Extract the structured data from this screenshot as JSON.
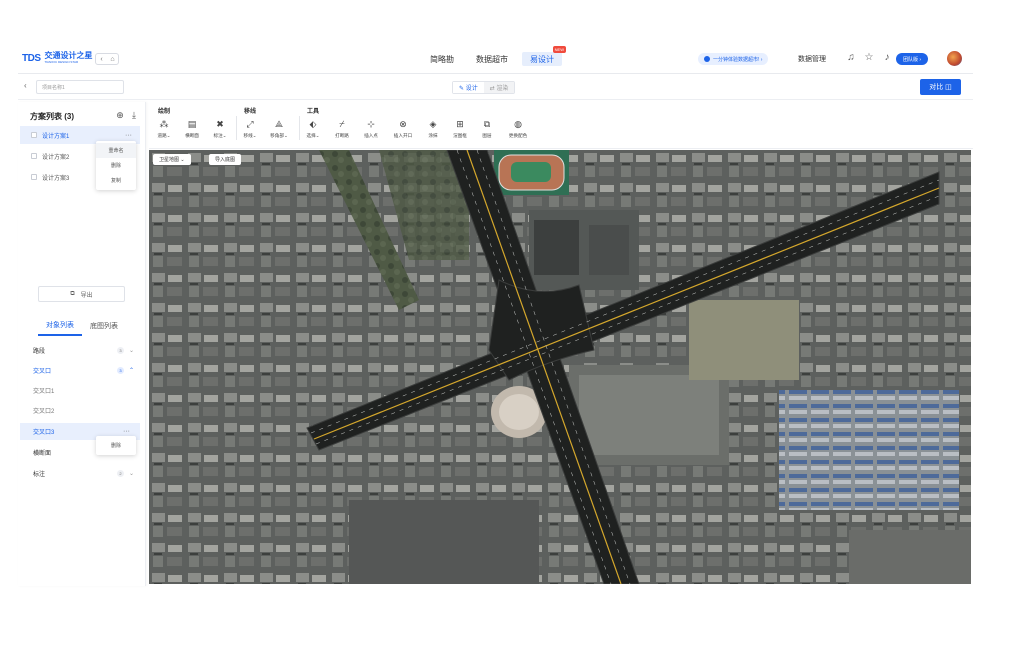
{
  "topbar": {
    "logo_mark": "TDS",
    "logo_cn": "交通设计之星",
    "logo_en": "TRAFFIC DESIGN STAR",
    "home_controls": [
      "‹",
      "⌂"
    ],
    "nav": [
      {
        "label": "简略勘",
        "active": false
      },
      {
        "label": "数据超市",
        "active": false
      },
      {
        "label": "易设计",
        "active": true,
        "badge": "NEW"
      }
    ],
    "promo": "一分钟体验数据超市! ›",
    "data_mgmt": "数据管理",
    "icons": [
      "headset-icon",
      "star-icon",
      "bell-icon"
    ],
    "team_btn": "团队版 ›"
  },
  "subbar": {
    "back": "‹",
    "project_name_placeholder": "项目名称1",
    "modes": [
      {
        "label": "✎ 设计",
        "active": true
      },
      {
        "label": "⇄ 渲染",
        "active": false
      }
    ],
    "compare_btn": "对比 ◫"
  },
  "left": {
    "title": "方案列表 (3)",
    "schemes": [
      {
        "label": "设计方案1",
        "selected": true
      },
      {
        "label": "设计方案2",
        "selected": false
      },
      {
        "label": "设计方案3",
        "selected": false
      }
    ],
    "scheme_menu": [
      "重命名",
      "删除",
      "复制"
    ],
    "export": "导出",
    "tabs": [
      {
        "label": "对象列表",
        "active": true
      },
      {
        "label": "底图列表",
        "active": false
      }
    ],
    "objects": [
      {
        "label": "路段",
        "count": "3",
        "chev": "⌄",
        "type": "group"
      },
      {
        "label": "交叉口",
        "count": "3",
        "chev": "⌃",
        "type": "group-open"
      },
      {
        "label": "交叉口1",
        "type": "child"
      },
      {
        "label": "交叉口2",
        "type": "child"
      },
      {
        "label": "交叉口3",
        "type": "child-selected"
      },
      {
        "label": "横断面",
        "type": "group"
      },
      {
        "label": "标注",
        "count": "2",
        "chev": "⌄",
        "type": "group"
      }
    ],
    "object_menu": [
      "删除"
    ]
  },
  "toolbar": {
    "groups": [
      {
        "label": "绘制",
        "tools": [
          {
            "icon": "⁂",
            "label": "道路⌄"
          },
          {
            "icon": "▤",
            "label": "横断面"
          },
          {
            "icon": "✖",
            "label": "标注⌄"
          }
        ]
      },
      {
        "label": "移线",
        "tools": [
          {
            "icon": "⤢",
            "label": "移线⌄"
          },
          {
            "icon": "⟁",
            "label": "移角部⌄"
          }
        ]
      },
      {
        "label": "工具",
        "tools": [
          {
            "icon": "⬖",
            "label": "选择⌄"
          },
          {
            "icon": "⌿",
            "label": "打断路"
          },
          {
            "icon": "⊹",
            "label": "插入点"
          },
          {
            "icon": "⊗",
            "label": "插入开口"
          },
          {
            "icon": "◈",
            "label": "涂抹"
          },
          {
            "icon": "⊞",
            "label": "渲图框"
          },
          {
            "icon": "⧉",
            "label": "图层"
          },
          {
            "icon": "◍",
            "label": "更换配色"
          }
        ]
      }
    ]
  },
  "map": {
    "basemap_select": "卫星地图  ⌄",
    "import_btn": "导入底图"
  }
}
